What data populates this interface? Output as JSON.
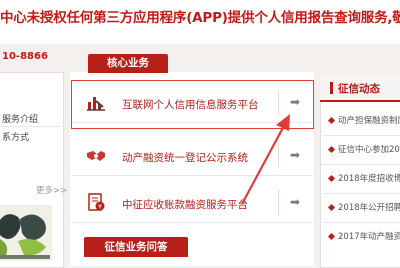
{
  "notice": {
    "text": "中心未授权任何第三方应用程序(APP)提供个人信用报告查询服务,敬请广大",
    "phone": "10-8866"
  },
  "left": {
    "links": [
      "服务介绍",
      "系方式"
    ],
    "more": "更多>>"
  },
  "core": {
    "tab": "核心业务",
    "items": [
      {
        "label": "互联网个人信用信息服务平台",
        "icon": "chart-icon"
      },
      {
        "label": "动产融资统一登记公示系统",
        "icon": "handshake-icon"
      },
      {
        "label": "中征应收账款融资服务平台",
        "icon": "document-money-icon"
      }
    ],
    "arrow": "➡"
  },
  "faq": {
    "tab": "征信业务问答"
  },
  "right": {
    "title": "征信动态",
    "news": [
      "动产担保融资制度",
      "征信中心参加20",
      "2018年度招收博",
      "2018年公开招聘",
      "2017年动产融资"
    ]
  },
  "colors": {
    "brand_red": "#b7201a",
    "annotation_red": "#e03b3b"
  }
}
